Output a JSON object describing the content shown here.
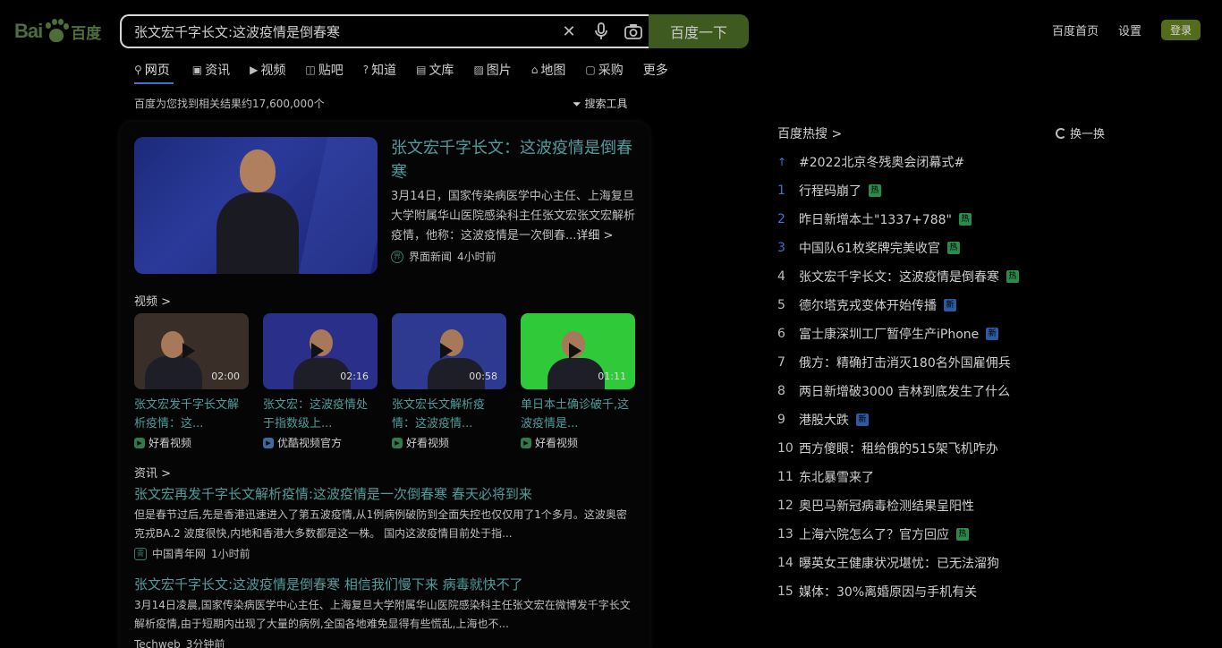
{
  "logo": {
    "bai": "Bai",
    "du": "百度"
  },
  "search": {
    "query": "张文宏千字长文:这波疫情是倒春寒",
    "button": "百度一下"
  },
  "header_links": {
    "home": "百度首页",
    "settings": "设置",
    "login": "登录"
  },
  "tabs": [
    {
      "label": "网页",
      "icon": "search-icon"
    },
    {
      "label": "资讯",
      "icon": "news-icon"
    },
    {
      "label": "视频",
      "icon": "video-icon"
    },
    {
      "label": "贴吧",
      "icon": "tieba-icon"
    },
    {
      "label": "知道",
      "icon": "question-icon"
    },
    {
      "label": "文库",
      "icon": "document-icon"
    },
    {
      "label": "图片",
      "icon": "image-icon"
    },
    {
      "label": "地图",
      "icon": "map-icon"
    },
    {
      "label": "采购",
      "icon": "cart-icon"
    },
    {
      "label": "更多",
      "icon": ""
    }
  ],
  "results_meta": {
    "count": "百度为您找到相关结果约17,600,000个",
    "tools": "搜索工具"
  },
  "hero": {
    "title": "张文宏千字长文：这波疫情是倒春寒",
    "desc": "3月14日，国家传染病医学中心主任、上海复旦大学附属华山医院感染科主任张文宏张文宏解析疫情，他称：这波疫情是一次倒春...",
    "more": "详细 >",
    "source": "界面新闻",
    "time": "4小时前"
  },
  "videos_section": "视频 >",
  "videos": [
    {
      "title": "张文宏发千字长文解析疫情：这...",
      "source": "好看视频",
      "duration": "02:00",
      "bg": "#3a2e28"
    },
    {
      "title": "张文宏：这波疫情处于指数级上...",
      "source": "优酷视频官方",
      "duration": "02:16",
      "bg": "#2a2f8a"
    },
    {
      "title": "张文宏长文解析疫情：这波疫情...",
      "source": "好看视频",
      "duration": "00:58",
      "bg": "#2d3a90"
    },
    {
      "title": "单日本土确诊破千,这波疫情是...",
      "source": "好看视频",
      "duration": "01:11",
      "bg": "#2fc93a"
    }
  ],
  "news_section": "资讯 >",
  "news": [
    {
      "title": "张文宏再发千字长文解析疫情:这波疫情是一次倒春寒 春天必将到来",
      "desc": "但是春节过后,先是香港迅速进入了第五波疫情,从1例病例破防到全面失控也仅仅用了1个多月。这波奥密克戎BA.2 波度很快,内地和香港大多数都是这一株。 国内这波疫情目前处于指...",
      "source": "中国青年网",
      "time": "1小时前"
    },
    {
      "title": "张文宏千字长文:这波疫情是倒春寒 相信我们慢下来 病毒就快不了",
      "desc": "3月14日凌晨,国家传染病医学中心主任、上海复旦大学附属华山医院感染科主任张文宏在微博发千字长文解析疫情,由于短期内出现了大量的病例,全国各地难免显得有些慌乱,上海也不...",
      "source": "Techweb",
      "time": "3分钟前"
    }
  ],
  "hot": {
    "title": "百度热搜 >",
    "refresh": "换一换",
    "items": [
      {
        "rank": "↑",
        "text": "#2022北京冬残奥会闭幕式#",
        "badge": ""
      },
      {
        "rank": "1",
        "text": "行程码崩了",
        "badge": "热"
      },
      {
        "rank": "2",
        "text": "昨日新增本土\"1337+788\"",
        "badge": "热"
      },
      {
        "rank": "3",
        "text": "中国队61枚奖牌完美收官",
        "badge": "热"
      },
      {
        "rank": "4",
        "text": "张文宏千字长文：这波疫情是倒春寒",
        "badge": "热"
      },
      {
        "rank": "5",
        "text": "德尔塔克戎变体开始传播",
        "badge": "新"
      },
      {
        "rank": "6",
        "text": "富士康深圳工厂暂停生产iPhone",
        "badge": "新"
      },
      {
        "rank": "7",
        "text": "俄方：精确打击消灭180名外国雇佣兵",
        "badge": ""
      },
      {
        "rank": "8",
        "text": "两日新增破3000 吉林到底发生了什么",
        "badge": ""
      },
      {
        "rank": "9",
        "text": "港股大跌",
        "badge": "新"
      },
      {
        "rank": "10",
        "text": "西方傻眼：租给俄的515架飞机咋办",
        "badge": ""
      },
      {
        "rank": "11",
        "text": "东北暴雪来了",
        "badge": ""
      },
      {
        "rank": "12",
        "text": "奥巴马新冠病毒检测结果呈阳性",
        "badge": ""
      },
      {
        "rank": "13",
        "text": "上海六院怎么了？官方回应",
        "badge": "热"
      },
      {
        "rank": "14",
        "text": "曝英女王健康状况堪忧：已无法溜狗",
        "badge": ""
      },
      {
        "rank": "15",
        "text": "媒体：30%离婚原因与手机有关",
        "badge": ""
      }
    ]
  }
}
